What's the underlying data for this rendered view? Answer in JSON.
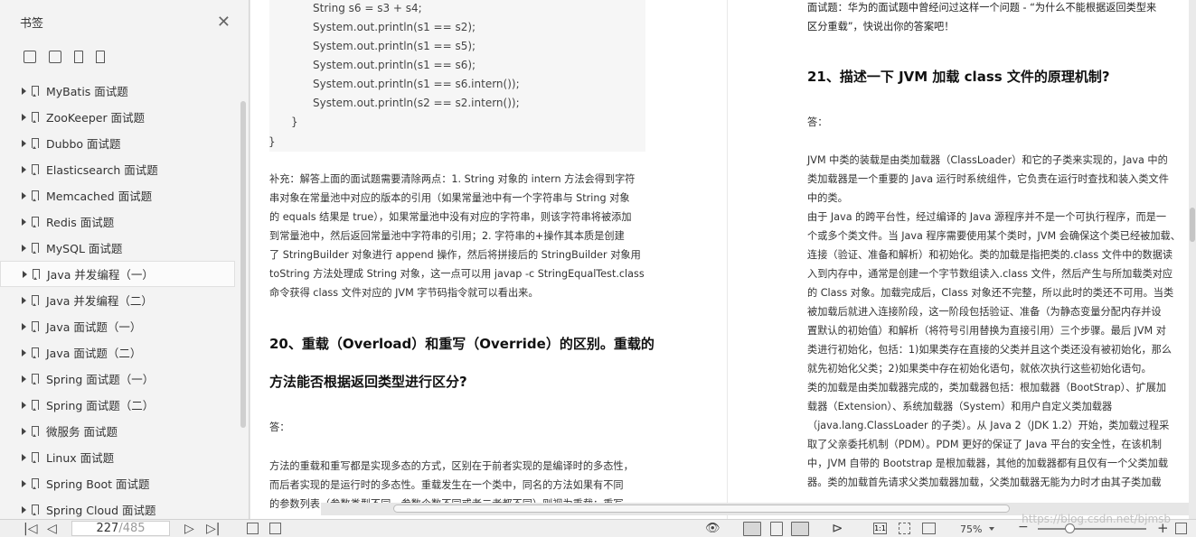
{
  "sidebar": {
    "title": "书签",
    "items": [
      {
        "label": "MyBatis 面试题"
      },
      {
        "label": "ZooKeeper 面试题"
      },
      {
        "label": "Dubbo 面试题"
      },
      {
        "label": "Elasticsearch 面试题"
      },
      {
        "label": "Memcached 面试题"
      },
      {
        "label": "Redis 面试题"
      },
      {
        "label": "MySQL 面试题"
      },
      {
        "label": "Java 并发编程（一）"
      },
      {
        "label": "Java 并发编程（二）"
      },
      {
        "label": "Java 面试题（一）"
      },
      {
        "label": "Java 面试题（二）"
      },
      {
        "label": "Spring 面试题（一）"
      },
      {
        "label": "Spring 面试题（二）"
      },
      {
        "label": "微服务 面试题"
      },
      {
        "label": "Linux 面试题"
      },
      {
        "label": "Spring Boot 面试题"
      },
      {
        "label": "Spring Cloud 面试题"
      }
    ]
  },
  "left_page": {
    "code_lines": [
      "String s6 = s3 + s4;",
      "System.out.println(s1 == s2);",
      "System.out.println(s1 == s5);",
      "System.out.println(s1 == s6);",
      "System.out.println(s1 == s6.intern());",
      "System.out.println(s2 == s2.intern());",
      "}",
      "}"
    ],
    "supplement_lines": [
      "补充：解答上面的面试题需要清除两点：1. String 对象的 intern 方法会得到字符",
      "串对象在常量池中对应的版本的引用（如果常量池中有一个字符串与 String 对象",
      "的 equals 结果是 true），如果常量池中没有对应的字符串，则该字符串将被添加",
      "到常量池中，然后返回常量池中字符串的引用；2. 字符串的+操作其本质是创建",
      "了 StringBuilder 对象进行 append 操作，然后将拼接后的 StringBuilder 对象用",
      "toString 方法处理成 String 对象，这一点可以用 javap -c StringEqualTest.class",
      "命令获得 class 文件对应的 JVM 字节码指令就可以看出来。"
    ],
    "heading_line1": "20、重载（Overload）和重写（Override）的区别。重载的",
    "heading_line2": "方法能否根据返回类型进行区分?",
    "answer_label": "答：",
    "answer_lines": [
      "方法的重载和重写都是实现多态的方式，区别在于前者实现的是编译时的多态性，",
      "而后者实现的是运行时的多态性。重载发生在一个类中，同名的方法如果有不同",
      "的参数列表（参数类型不同、参数个数不同或者二者都不同）则视为重载；重写"
    ]
  },
  "right_page": {
    "intro_lines": [
      "面试题：华为的面试题中曾经问过这样一个问题 - “为什么不能根据返回类型来",
      "区分重载”，快说出你的答案吧！"
    ],
    "heading": "21、描述一下 JVM 加载 class 文件的原理机制?",
    "answer_label": "答：",
    "body_lines": [
      "JVM 中类的装载是由类加载器（ClassLoader）和它的子类来实现的，Java 中的",
      "类加载器是一个重要的 Java 运行时系统组件，它负责在运行时查找和装入类文件",
      "中的类。",
      "由于 Java 的跨平台性，经过编译的 Java 源程序并不是一个可执行程序，而是一",
      "个或多个类文件。当 Java 程序需要使用某个类时，JVM 会确保这个类已经被加载、",
      "连接（验证、准备和解析）和初始化。类的加载是指把类的.class 文件中的数据读",
      "入到内存中，通常是创建一个字节数组读入.class 文件，然后产生与所加载类对应",
      "的 Class 对象。加载完成后，Class 对象还不完整，所以此时的类还不可用。当类",
      "被加载后就进入连接阶段，这一阶段包括验证、准备（为静态变量分配内存并设",
      "置默认的初始值）和解析（将符号引用替换为直接引用）三个步骤。最后 JVM 对",
      "类进行初始化，包括：1)如果类存在直接的父类并且这个类还没有被初始化，那么",
      "就先初始化父类；2)如果类中存在初始化语句，就依次执行这些初始化语句。",
      "类的加载是由类加载器完成的，类加载器包括：根加载器（BootStrap）、扩展加",
      "载器（Extension）、系统加载器（System）和用户自定义类加载器",
      "（java.lang.ClassLoader 的子类）。从 Java 2（JDK 1.2）开始，类加载过程采",
      "取了父亲委托机制（PDM）。PDM 更好的保证了 Java 平台的安全性，在该机制",
      "中，JVM 自带的 Bootstrap 是根加载器，其他的加载器都有且仅有一个父类加载",
      "器。类的加载首先请求父类加载器加载，父类加载器无能为力时才由其子类加载"
    ]
  },
  "toolbar": {
    "current_page": "227",
    "total_pages": "/485",
    "zoom": "75%",
    "minus": "−",
    "plus": "+",
    "first": "|◁",
    "prev": "◁",
    "next": "▷",
    "last": "▷|"
  },
  "watermark": "https://blog.csdn.net/bjmsb"
}
